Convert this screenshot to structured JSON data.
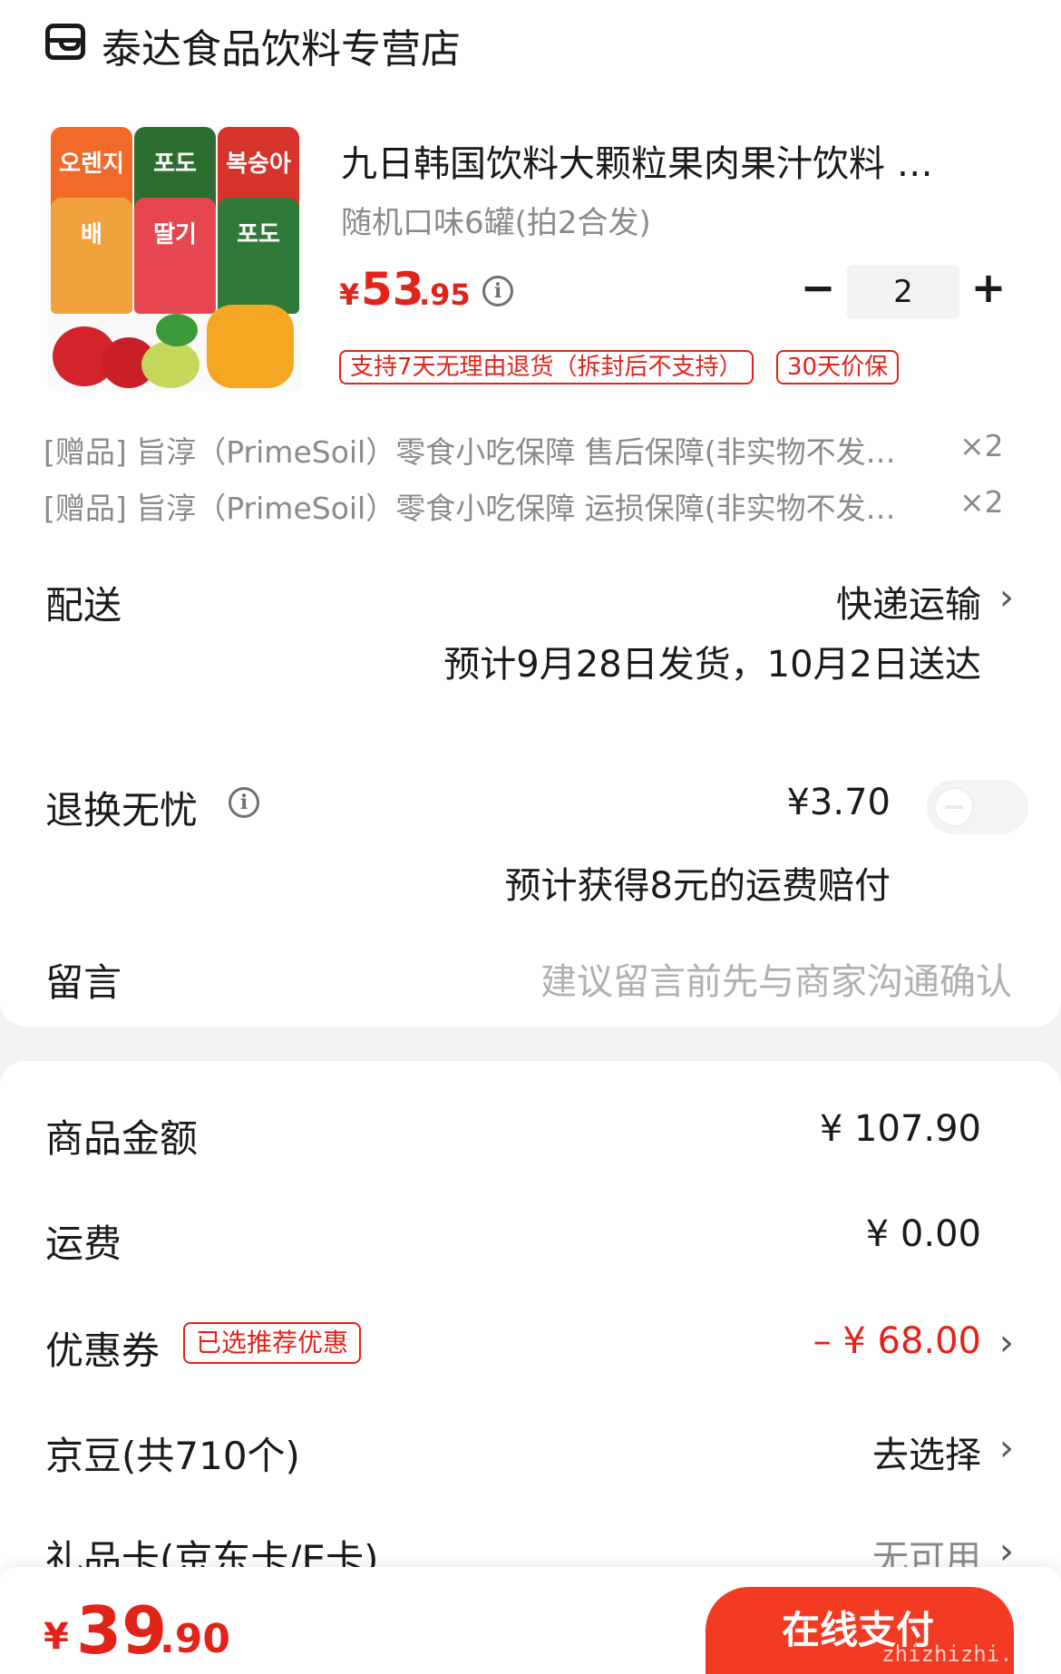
{
  "store": {
    "name": "泰达食品饮料专营店",
    "icon": "store-icon"
  },
  "product": {
    "title": "九日韩国饮料大颗粒果肉果汁饮料 …",
    "spec": "随机口味6罐(拍2合发)",
    "price_symbol": "¥",
    "price_int": "53",
    "price_dec": ".95",
    "quantity": "2",
    "minus": "−",
    "plus": "+",
    "tags": [
      "支持7天无理由退货（拆封后不支持）",
      "30天价保"
    ],
    "image_can_labels": [
      "오렌지",
      "포도",
      "복숭아",
      "배",
      "딸기",
      "포도"
    ]
  },
  "gifts": [
    {
      "text": "[赠品] 旨淳（PrimeSoil）零食小吃保障 售后保障(非实物不发…",
      "qty": "×2"
    },
    {
      "text": "[赠品] 旨淳（PrimeSoil）零食小吃保障 运损保障(非实物不发…",
      "qty": "×2"
    }
  ],
  "delivery": {
    "label": "配送",
    "method": "快递运输",
    "eta": "预计9月28日发货，10月2日送达"
  },
  "return_worry_free": {
    "label": "退换无忧",
    "price": "¥3.70",
    "note": "预计获得8元的运费赔付",
    "enabled": false
  },
  "message": {
    "label": "留言",
    "placeholder": "建议留言前先与商家沟通确认"
  },
  "summary": {
    "goods_amount_label": "商品金额",
    "goods_amount": "¥ 107.90",
    "shipping_label": "运费",
    "shipping": "¥ 0.00",
    "coupon_label": "优惠券",
    "coupon_tag": "已选推荐优惠",
    "coupon_value": "– ¥ 68.00",
    "jd_bean_label": "京豆(共710个)",
    "jd_bean_action": "去选择",
    "gift_card_label": "礼品卡(京东卡/E卡)",
    "gift_card_value": "无可用"
  },
  "footer": {
    "total_symbol": "¥",
    "total_int": "39",
    "total_dec": ".90",
    "pay_button": "在线支付",
    "watermark": "zhizhizhi.com"
  },
  "colors": {
    "accent": "#e2231a",
    "pay_button": "#f23b22",
    "muted": "#8a8a8a"
  }
}
